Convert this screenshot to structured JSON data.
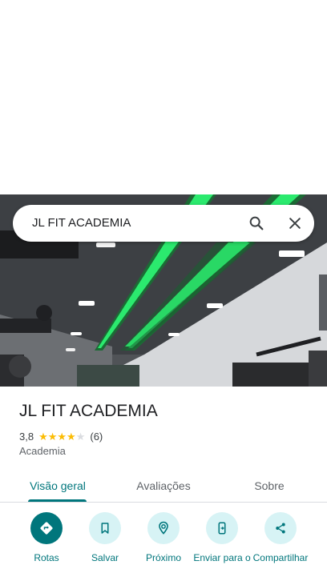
{
  "search": {
    "query": "JL FIT ACADEMIA"
  },
  "place": {
    "name": "JL FIT ACADEMIA",
    "rating": "3,8",
    "stars": 4,
    "review_count": "(6)",
    "category": "Academia"
  },
  "tabs": [
    {
      "label": "Visão geral",
      "active": true
    },
    {
      "label": "Avaliações",
      "active": false
    },
    {
      "label": "Sobre",
      "active": false
    }
  ],
  "actions": [
    {
      "label": "Rotas",
      "icon": "directions-icon"
    },
    {
      "label": "Salvar",
      "icon": "bookmark-icon"
    },
    {
      "label": "Próximo",
      "icon": "nearby-icon"
    },
    {
      "label": "Enviar para o",
      "icon": "send-to-phone-icon"
    },
    {
      "label": "Compartilhar",
      "icon": "share-icon"
    }
  ],
  "colors": {
    "accent": "#00767c",
    "accent_light": "#d7f3f5",
    "star": "#fbbc04",
    "led": "#22e36a"
  }
}
